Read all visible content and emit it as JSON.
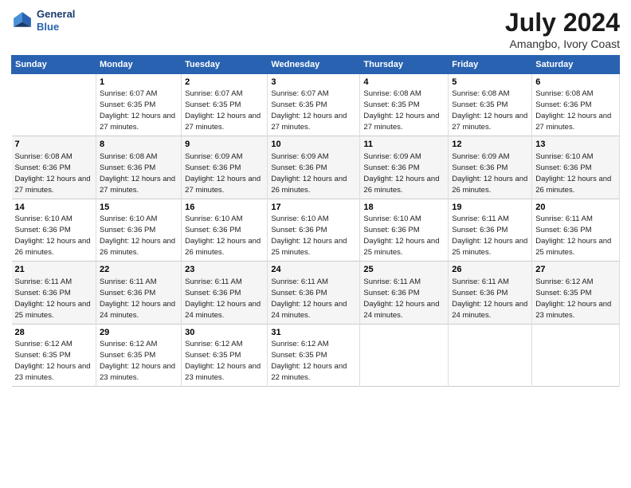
{
  "header": {
    "logo_line1": "General",
    "logo_line2": "Blue",
    "title": "July 2024",
    "subtitle": "Amangbo, Ivory Coast"
  },
  "weekdays": [
    "Sunday",
    "Monday",
    "Tuesday",
    "Wednesday",
    "Thursday",
    "Friday",
    "Saturday"
  ],
  "weeks": [
    [
      {
        "day": "",
        "sunrise": "",
        "sunset": "",
        "daylight": ""
      },
      {
        "day": "1",
        "sunrise": "6:07 AM",
        "sunset": "6:35 PM",
        "daylight": "12 hours and 27 minutes."
      },
      {
        "day": "2",
        "sunrise": "6:07 AM",
        "sunset": "6:35 PM",
        "daylight": "12 hours and 27 minutes."
      },
      {
        "day": "3",
        "sunrise": "6:07 AM",
        "sunset": "6:35 PM",
        "daylight": "12 hours and 27 minutes."
      },
      {
        "day": "4",
        "sunrise": "6:08 AM",
        "sunset": "6:35 PM",
        "daylight": "12 hours and 27 minutes."
      },
      {
        "day": "5",
        "sunrise": "6:08 AM",
        "sunset": "6:35 PM",
        "daylight": "12 hours and 27 minutes."
      },
      {
        "day": "6",
        "sunrise": "6:08 AM",
        "sunset": "6:36 PM",
        "daylight": "12 hours and 27 minutes."
      }
    ],
    [
      {
        "day": "7",
        "sunrise": "6:08 AM",
        "sunset": "6:36 PM",
        "daylight": "12 hours and 27 minutes."
      },
      {
        "day": "8",
        "sunrise": "6:08 AM",
        "sunset": "6:36 PM",
        "daylight": "12 hours and 27 minutes."
      },
      {
        "day": "9",
        "sunrise": "6:09 AM",
        "sunset": "6:36 PM",
        "daylight": "12 hours and 27 minutes."
      },
      {
        "day": "10",
        "sunrise": "6:09 AM",
        "sunset": "6:36 PM",
        "daylight": "12 hours and 26 minutes."
      },
      {
        "day": "11",
        "sunrise": "6:09 AM",
        "sunset": "6:36 PM",
        "daylight": "12 hours and 26 minutes."
      },
      {
        "day": "12",
        "sunrise": "6:09 AM",
        "sunset": "6:36 PM",
        "daylight": "12 hours and 26 minutes."
      },
      {
        "day": "13",
        "sunrise": "6:10 AM",
        "sunset": "6:36 PM",
        "daylight": "12 hours and 26 minutes."
      }
    ],
    [
      {
        "day": "14",
        "sunrise": "6:10 AM",
        "sunset": "6:36 PM",
        "daylight": "12 hours and 26 minutes."
      },
      {
        "day": "15",
        "sunrise": "6:10 AM",
        "sunset": "6:36 PM",
        "daylight": "12 hours and 26 minutes."
      },
      {
        "day": "16",
        "sunrise": "6:10 AM",
        "sunset": "6:36 PM",
        "daylight": "12 hours and 26 minutes."
      },
      {
        "day": "17",
        "sunrise": "6:10 AM",
        "sunset": "6:36 PM",
        "daylight": "12 hours and 25 minutes."
      },
      {
        "day": "18",
        "sunrise": "6:10 AM",
        "sunset": "6:36 PM",
        "daylight": "12 hours and 25 minutes."
      },
      {
        "day": "19",
        "sunrise": "6:11 AM",
        "sunset": "6:36 PM",
        "daylight": "12 hours and 25 minutes."
      },
      {
        "day": "20",
        "sunrise": "6:11 AM",
        "sunset": "6:36 PM",
        "daylight": "12 hours and 25 minutes."
      }
    ],
    [
      {
        "day": "21",
        "sunrise": "6:11 AM",
        "sunset": "6:36 PM",
        "daylight": "12 hours and 25 minutes."
      },
      {
        "day": "22",
        "sunrise": "6:11 AM",
        "sunset": "6:36 PM",
        "daylight": "12 hours and 24 minutes."
      },
      {
        "day": "23",
        "sunrise": "6:11 AM",
        "sunset": "6:36 PM",
        "daylight": "12 hours and 24 minutes."
      },
      {
        "day": "24",
        "sunrise": "6:11 AM",
        "sunset": "6:36 PM",
        "daylight": "12 hours and 24 minutes."
      },
      {
        "day": "25",
        "sunrise": "6:11 AM",
        "sunset": "6:36 PM",
        "daylight": "12 hours and 24 minutes."
      },
      {
        "day": "26",
        "sunrise": "6:11 AM",
        "sunset": "6:36 PM",
        "daylight": "12 hours and 24 minutes."
      },
      {
        "day": "27",
        "sunrise": "6:12 AM",
        "sunset": "6:35 PM",
        "daylight": "12 hours and 23 minutes."
      }
    ],
    [
      {
        "day": "28",
        "sunrise": "6:12 AM",
        "sunset": "6:35 PM",
        "daylight": "12 hours and 23 minutes."
      },
      {
        "day": "29",
        "sunrise": "6:12 AM",
        "sunset": "6:35 PM",
        "daylight": "12 hours and 23 minutes."
      },
      {
        "day": "30",
        "sunrise": "6:12 AM",
        "sunset": "6:35 PM",
        "daylight": "12 hours and 23 minutes."
      },
      {
        "day": "31",
        "sunrise": "6:12 AM",
        "sunset": "6:35 PM",
        "daylight": "12 hours and 22 minutes."
      },
      {
        "day": "",
        "sunrise": "",
        "sunset": "",
        "daylight": ""
      },
      {
        "day": "",
        "sunrise": "",
        "sunset": "",
        "daylight": ""
      },
      {
        "day": "",
        "sunrise": "",
        "sunset": "",
        "daylight": ""
      }
    ]
  ]
}
